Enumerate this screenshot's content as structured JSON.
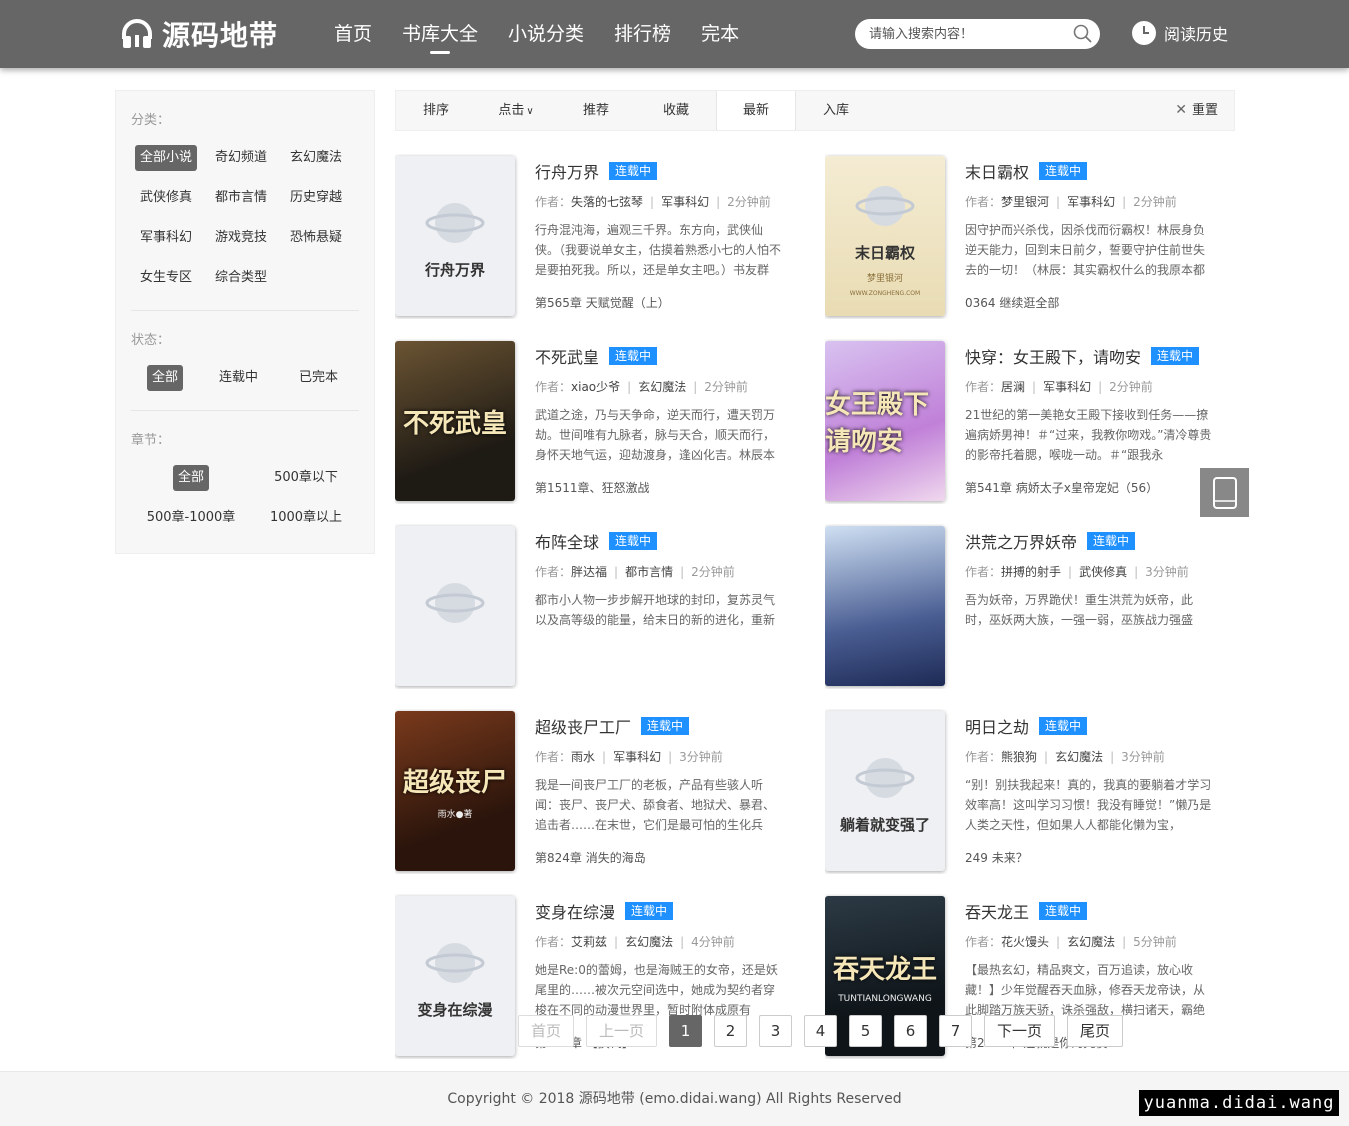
{
  "header": {
    "logo_text": "源码地带",
    "nav": [
      "首页",
      "书库大全",
      "小说分类",
      "排行榜",
      "完本"
    ],
    "search_placeholder": "请输入搜索内容！",
    "history_label": "阅读历史"
  },
  "sidebar": {
    "category_title": "分类：",
    "categories": [
      "全部小说",
      "奇幻频道",
      "玄幻魔法",
      "武侠修真",
      "都市言情",
      "历史穿越",
      "军事科幻",
      "游戏竞技",
      "恐怖悬疑",
      "女生专区",
      "综合类型"
    ],
    "status_title": "状态：",
    "statuses": [
      "全部",
      "连载中",
      "已完本"
    ],
    "chapter_title": "章节：",
    "chapters": [
      "全部",
      "500章以下",
      "500章-1000章",
      "1000章以上"
    ]
  },
  "sortbar": {
    "items": [
      "排序",
      "点击",
      "推荐",
      "收藏",
      "最新",
      "入库"
    ],
    "reset_label": "重置"
  },
  "author_prefix": "作者：",
  "books": [
    {
      "title": "行舟万界",
      "status": "连载中",
      "author": "失落的七弦琴",
      "category": "军事科幻",
      "time": "2分钟前",
      "desc": "行舟混沌海，遍观三千界。东方向，武侠仙侠。（我要说单女主，估摸着熟悉小七的人怕不是要拍死我。所以，还是单女主吧。）书友群",
      "latest": "第565章 天赋觉醒（上）",
      "cover_text": "行舟万界"
    },
    {
      "title": "末日霸权",
      "status": "连载中",
      "author": "梦里银河",
      "category": "军事科幻",
      "time": "2分钟前",
      "desc": "因守护而兴杀伐，因杀伐而衍霸权！林辰身负逆天能力，回到末日前夕，誓要守护住前世失去的一切！（林辰：其实霸权什么的我原本都",
      "latest": "0364 继续逛全部",
      "cover_text": "末日霸权",
      "cover_author": "梦里银河",
      "cover_site": "WWW.ZONGHENG.COM"
    },
    {
      "title": "不死武皇",
      "status": "连载中",
      "author": "xiao少爷",
      "category": "玄幻魔法",
      "time": "2分钟前",
      "desc": "武道之途，乃与天争命，逆天而行，遭天罚万劫。世间唯有九脉者，脉与天合，顺天而行，身怀天地气运，迎劫渡身，逢凶化吉。林辰本",
      "latest": "第1511章、狂怒激战",
      "cover_text": "不死武皇"
    },
    {
      "title": "快穿：女王殿下，请吻安",
      "status": "连载中",
      "author": "居澜",
      "category": "军事科幻",
      "time": "2分钟前",
      "desc": "21世纪的第一美艳女王殿下接收到任务——撩遍病娇男神！＃“过来，我教你吻戏。”清冷尊贵的影帝托着腮，喉咙一动。＃“跟我永",
      "latest": "第541章 病娇太子x皇帝宠妃（56）",
      "cover_text": "女王殿下请吻安"
    },
    {
      "title": "布阵全球",
      "status": "连载中",
      "author": "胖达福",
      "category": "都市言情",
      "time": "2分钟前",
      "desc": "都市小人物一步步解开地球的封印，复苏灵气以及高等级的能量，给末日的新的进化，重新",
      "latest": "",
      "cover_text": ""
    },
    {
      "title": "洪荒之万界妖帝",
      "status": "连载中",
      "author": "拼搏的射手",
      "category": "武侠修真",
      "time": "3分钟前",
      "desc": "吾为妖帝，万界跪伏！重生洪荒为妖帝，此时，巫妖两大族，一强一弱，巫族战力强盛",
      "latest": "",
      "cover_text": ""
    },
    {
      "title": "超级丧尸工厂",
      "status": "连载中",
      "author": "雨水",
      "category": "军事科幻",
      "time": "3分钟前",
      "desc": "我是一间丧尸工厂的老板，产品有些骇人听闻：丧尸、丧尸犬、舔食者、地狱犬、暴君、追击者……在末世，它们是最可怕的生化兵",
      "latest": "第824章 消失的海岛",
      "cover_text": "超级丧尸",
      "cover_author": "雨水●著"
    },
    {
      "title": "明日之劫",
      "status": "连载中",
      "author": "熊狼狗",
      "category": "玄幻魔法",
      "time": "3分钟前",
      "desc": "“别！别扶我起来！真的，我真的要躺着才学习效率高！这叫学习习惯！我没有睡觉！”懒乃是人类之天性，但如果人人都能化懒为宝，",
      "latest": "249 未来？",
      "cover_text": "躺着就变强了"
    },
    {
      "title": "变身在综漫",
      "status": "连载中",
      "author": "艾莉兹",
      "category": "玄幻魔法",
      "time": "4分钟前",
      "desc": "她是Re:0的蕾姆，也是海贼王的女帝，还是妖尾里的……被次元空间选中，她成为契约者穿梭在不同的动漫世界里，暂时附体成原有",
      "latest": "第152章 【换代】",
      "cover_text": "变身在综漫"
    },
    {
      "title": "吞天龙王",
      "status": "连载中",
      "author": "花火馒头",
      "category": "玄幻魔法",
      "time": "5分钟前",
      "desc": "【最热玄幻，精品爽文，百万追读，放心收藏！】少年觉醒吞天血脉，修吞天龙帝诀，从此脚踏万族天骄，诛杀强敌，横扫诸天，霸绝",
      "latest": "第2456章 这就是你的凭仗？",
      "cover_text": "吞天龙王",
      "cover_author": "TUNTIANLONGWANG"
    }
  ],
  "pager": {
    "first": "首页",
    "prev": "上一页",
    "pages": [
      "1",
      "2",
      "3",
      "4",
      "5",
      "6",
      "7"
    ],
    "next": "下一页",
    "last": "尾页"
  },
  "footer": {
    "copyright": "Copyright © 2018 源码地带 (emo.didai.wang) All Rights Reserved",
    "watermark": "yuanma.didai.wang"
  },
  "colors": {
    "header_bg": "#666666",
    "badge": "#1e90ff",
    "active_tag": "#666666"
  }
}
